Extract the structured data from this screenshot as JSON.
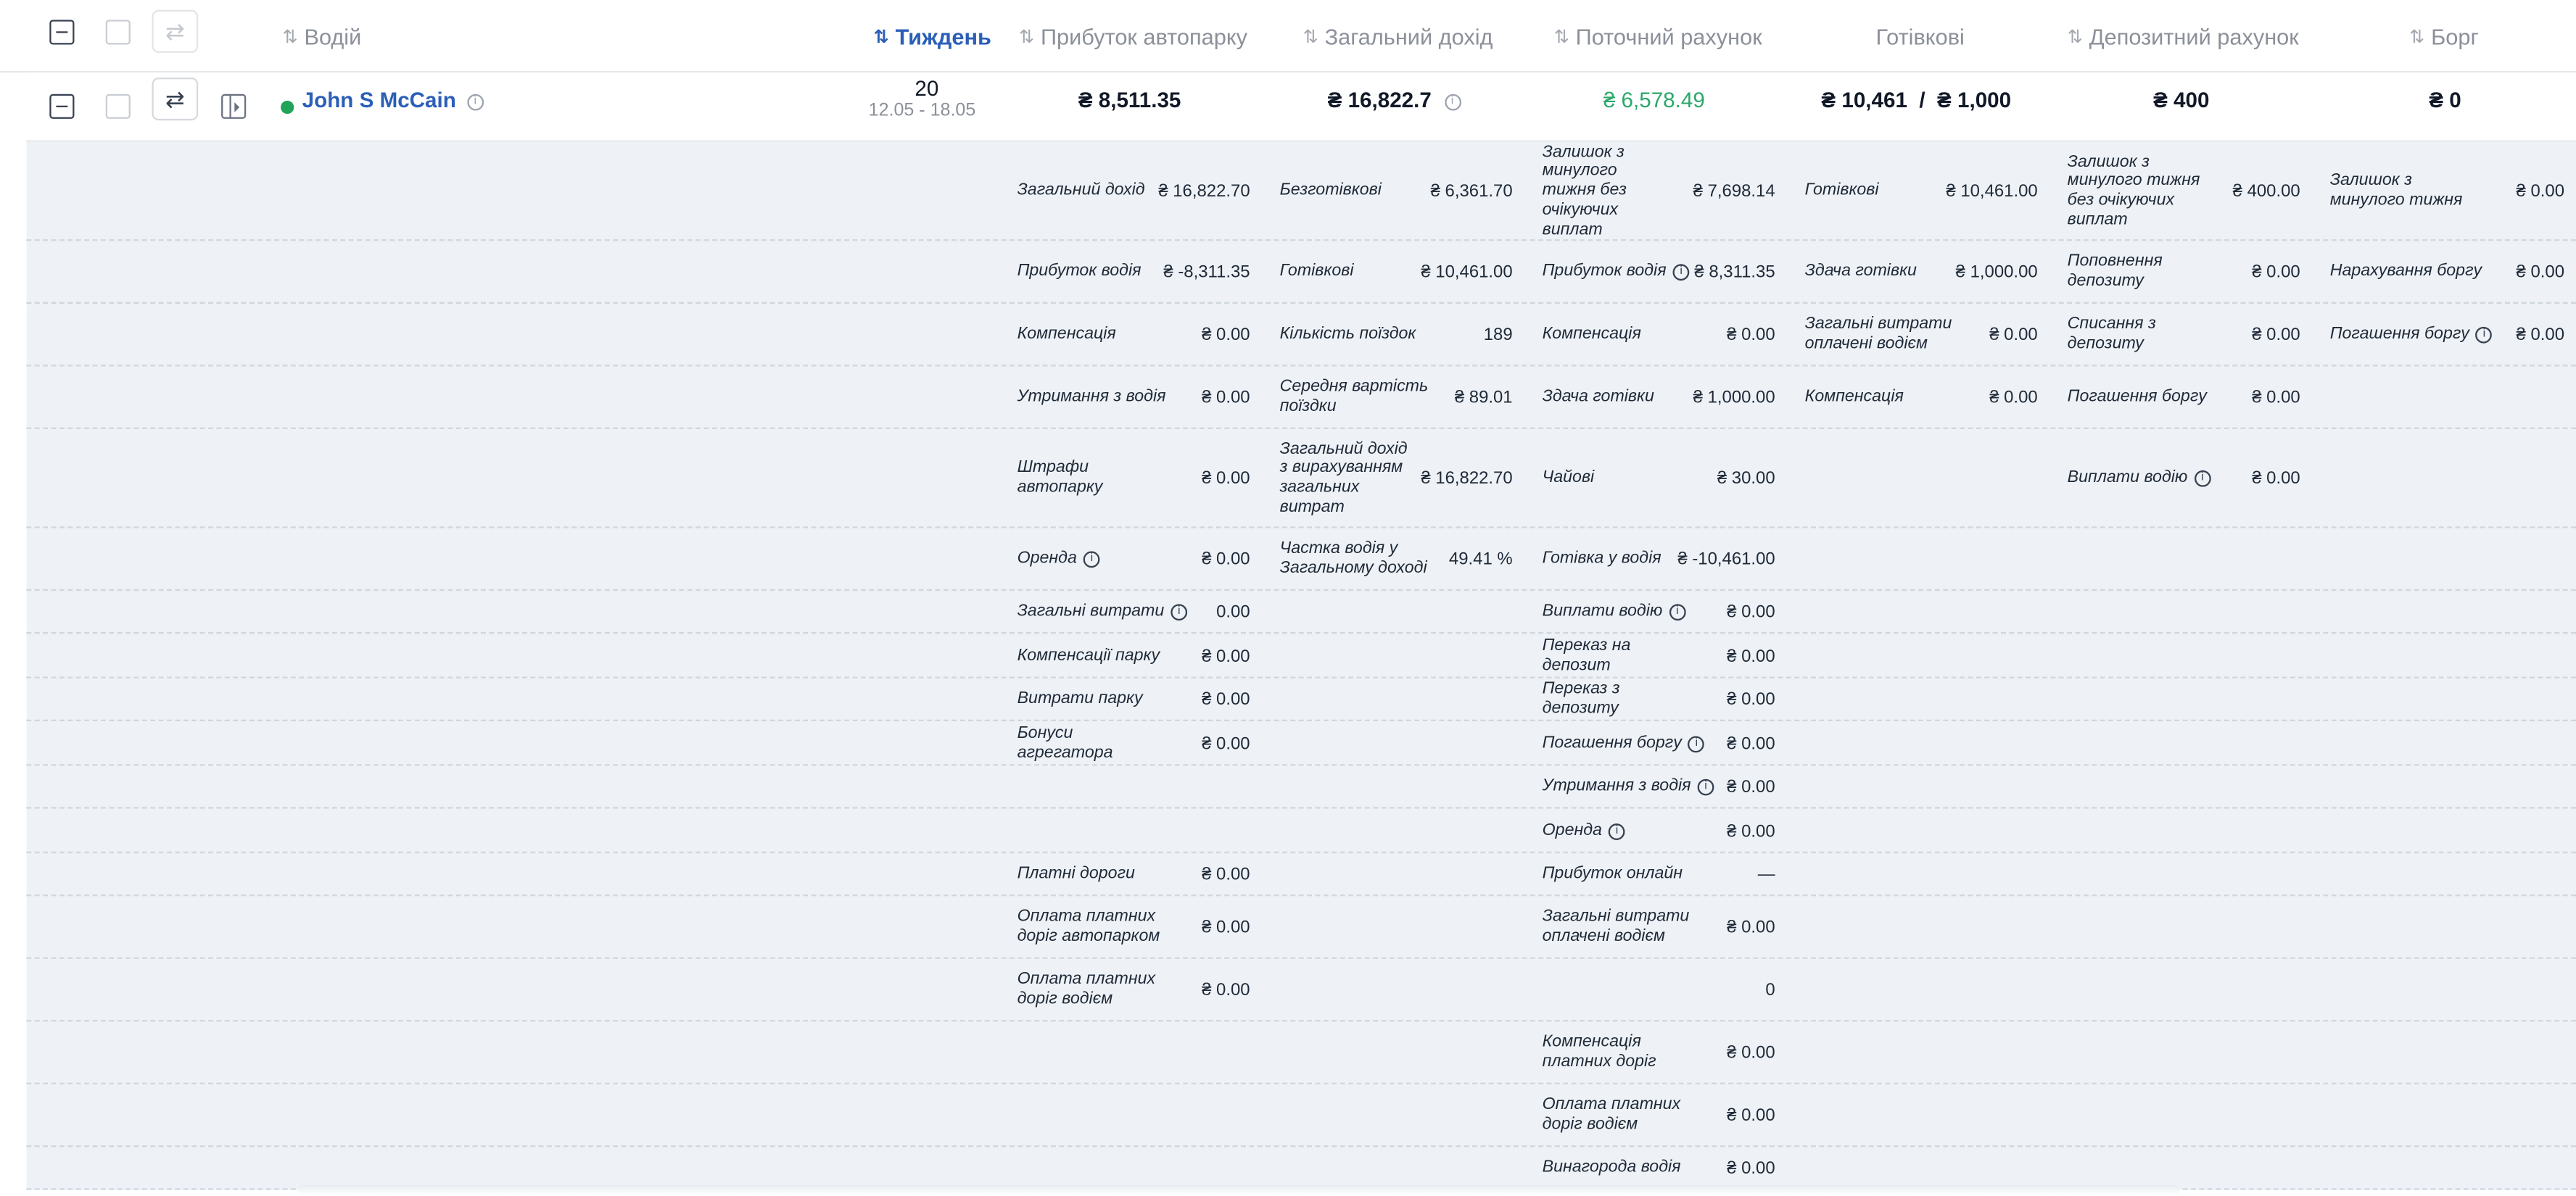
{
  "header": {
    "columns": [
      {
        "key": "driver",
        "label": "Водій",
        "sortable": true,
        "active": false
      },
      {
        "key": "week",
        "label": "Тиждень",
        "sortable": true,
        "active": true
      },
      {
        "key": "fleet_profit",
        "label": "Прибуток автопарку",
        "sortable": true,
        "active": false
      },
      {
        "key": "total_income",
        "label": "Загальний дохід",
        "sortable": true,
        "active": false
      },
      {
        "key": "current_account",
        "label": "Поточний рахунок",
        "sortable": true,
        "active": false
      },
      {
        "key": "cash",
        "label": "Готівкові",
        "sortable": false,
        "active": false
      },
      {
        "key": "deposit_account",
        "label": "Депозитний рахунок",
        "sortable": true,
        "active": false
      },
      {
        "key": "debt",
        "label": "Борг",
        "sortable": true,
        "active": false
      }
    ],
    "sort_icon": "⇅",
    "active_color": "#2b5fb8"
  },
  "row": {
    "driver_name": "John S McCain",
    "status": "online",
    "status_color": "#22a35a",
    "week_number": "20",
    "week_range": "12.05 - 18.05",
    "fleet_profit": "₴ 8,511.35",
    "total_income": "₴ 16,822.7",
    "current_account": "₴ 6,578.49",
    "cash": "₴ 10,461  /  ₴ 1,000",
    "deposit": "₴ 400",
    "debt": "₴ 0"
  },
  "details": {
    "rows": [
      [
        {
          "label": "Загальний дохід",
          "value": "₴ 16,822.70"
        },
        {
          "label": "Безготівкові",
          "value": "₴ 6,361.70"
        },
        {
          "label": "Залишок з минулого тижня без очікуючих виплат",
          "value": "₴ 7,698.14"
        },
        {
          "label": "Готівкові",
          "value": "₴ 10,461.00"
        },
        {
          "label": "Залишок з минулого тижня без очікуючих виплат",
          "value": "₴ 400.00"
        },
        {
          "label": "Залишок з минулого тижня",
          "value": "₴ 0.00"
        }
      ],
      [
        {
          "label": "Прибуток водія",
          "value": "₴ -8,311.35"
        },
        {
          "label": "Готівкові",
          "value": "₴ 10,461.00"
        },
        {
          "label": "Прибуток водія",
          "value": "₴ 8,311.35",
          "info": true
        },
        {
          "label": "Здача готівки",
          "value": "₴ 1,000.00"
        },
        {
          "label": "Поповнення депозиту",
          "value": "₴ 0.00"
        },
        {
          "label": "Нарахування боргу",
          "value": "₴ 0.00"
        }
      ],
      [
        {
          "label": "Компенсація",
          "value": "₴ 0.00"
        },
        {
          "label": "Кількість поїздок",
          "value": "189"
        },
        {
          "label": "Компенсація",
          "value": "₴ 0.00"
        },
        {
          "label": "Загальні витрати оплачені водієм",
          "value": "₴ 0.00"
        },
        {
          "label": "Списання з депозиту",
          "value": "₴ 0.00"
        },
        {
          "label": "Погашення боргу",
          "value": "₴ 0.00",
          "info": true
        }
      ],
      [
        {
          "label": "Утримання з водія",
          "value": "₴ 0.00"
        },
        {
          "label": "Середня вартість поїздки",
          "value": "₴ 89.01"
        },
        {
          "label": "Здача готівки",
          "value": "₴ 1,000.00"
        },
        {
          "label": "Компенсація",
          "value": "₴ 0.00"
        },
        {
          "label": "Погашення боргу",
          "value": "₴ 0.00"
        },
        null
      ],
      [
        {
          "label": "Штрафи автопарку",
          "value": "₴ 0.00"
        },
        {
          "label": "Загальний дохід з вирахуванням загальних витрат",
          "value": "₴ 16,822.70"
        },
        {
          "label": "Чайові",
          "value": "₴ 30.00"
        },
        null,
        {
          "label": "Виплати водію",
          "value": "₴ 0.00",
          "info": true
        },
        null
      ],
      [
        {
          "label": "Оренда",
          "value": "₴ 0.00",
          "info": true
        },
        {
          "label": "Частка водія у Загальному доході",
          "value": "49.41 %"
        },
        {
          "label": "Готівка у водія",
          "value": "₴ -10,461.00"
        },
        null,
        null,
        null
      ],
      [
        {
          "label": "Загальні витрати",
          "value": "0.00",
          "info": true
        },
        null,
        {
          "label": "Виплати водію",
          "value": "₴ 0.00",
          "info": true
        },
        null,
        null,
        null
      ],
      [
        {
          "label": "Компенсації парку",
          "value": "₴ 0.00"
        },
        null,
        {
          "label": "Переказ на депозит",
          "value": "₴ 0.00"
        },
        null,
        null,
        null
      ],
      [
        {
          "label": "Витрати парку",
          "value": "₴ 0.00"
        },
        null,
        {
          "label": "Переказ з депозиту",
          "value": "₴ 0.00"
        },
        null,
        null,
        null
      ],
      [
        {
          "label": "Бонуси агрегатора",
          "value": "₴ 0.00"
        },
        null,
        {
          "label": "Погашення боргу",
          "value": "₴ 0.00",
          "info": true
        },
        null,
        null,
        null
      ],
      [
        null,
        null,
        {
          "label": "Утримання з водія",
          "value": "₴ 0.00",
          "info": true
        },
        null,
        null,
        null
      ],
      [
        null,
        null,
        {
          "label": "Оренда",
          "value": "₴ 0.00",
          "info": true
        },
        null,
        null,
        null
      ],
      [
        {
          "label": "Платні дороги",
          "value": "₴ 0.00"
        },
        null,
        {
          "label": "Прибуток онлайн",
          "value": "—"
        },
        null,
        null,
        null
      ],
      [
        {
          "label": "Оплата платних доріг автопарком",
          "value": "₴ 0.00"
        },
        null,
        {
          "label": "Загальні витрати оплачені водієм",
          "value": "₴ 0.00"
        },
        null,
        null,
        null
      ],
      [
        {
          "label": "Оплата платних доріг водієм",
          "value": "₴ 0.00"
        },
        null,
        {
          "label": "",
          "value": "0"
        },
        null,
        null,
        null
      ],
      [
        null,
        null,
        {
          "label": "Компенсація платних доріг",
          "value": "₴ 0.00"
        },
        null,
        null,
        null
      ],
      [
        null,
        null,
        {
          "label": "Оплата платних доріг водієм",
          "value": "₴ 0.00"
        },
        null,
        null,
        null
      ],
      [
        null,
        null,
        {
          "label": "Винагорода водія",
          "value": "₴ 0.00"
        },
        null,
        null,
        null
      ]
    ]
  }
}
